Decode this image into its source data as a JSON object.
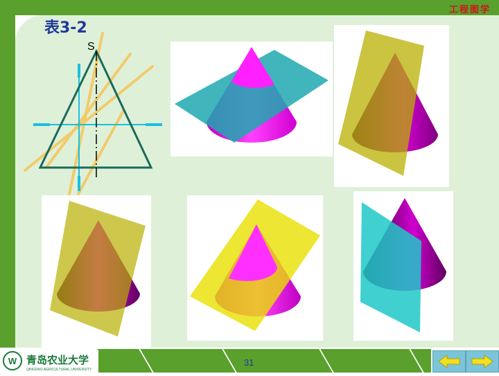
{
  "header": {
    "title": "工程图学"
  },
  "slide": {
    "table_title": "表3-2",
    "apex_label": "S"
  },
  "footer": {
    "page_number": "31",
    "logo_text": "青岛农业大学",
    "logo_subtext": "QINGDAO AGRICULTURAL UNIVERSITY"
  },
  "nav": {
    "prev_icon": "left-arrow-icon",
    "next_icon": "right-arrow-icon"
  },
  "colors": {
    "band_green": "#5aa02c",
    "cone_magenta": "#ff00ff",
    "plane_teal": "#1fa8b0",
    "plane_olive": "#b8b000",
    "plane_yellow": "#e8e000",
    "title_blue": "#1f3a9a",
    "header_red": "#d0161b"
  }
}
